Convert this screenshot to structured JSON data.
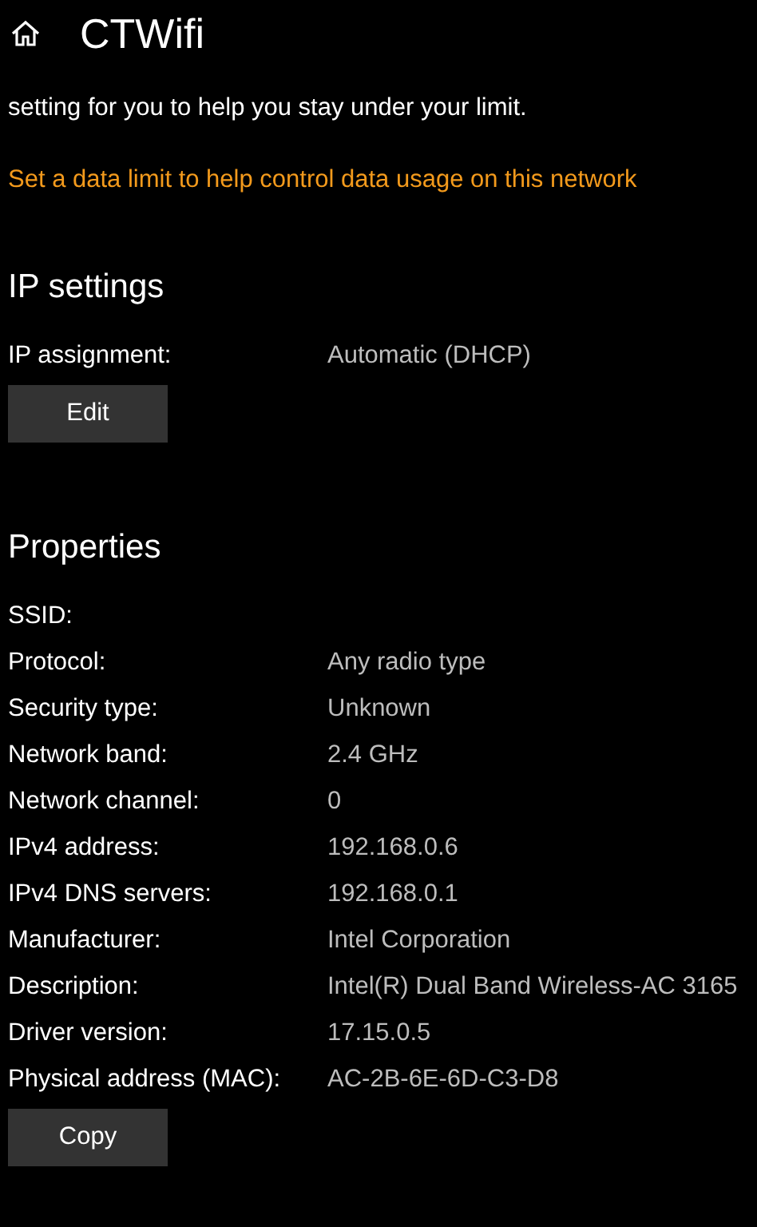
{
  "header": {
    "title": "CTWifi"
  },
  "intro": {
    "text": "setting for you to help you stay under your limit.",
    "link": "Set a data limit to help control data usage on this network"
  },
  "ip_settings": {
    "heading": "IP settings",
    "rows": [
      {
        "label": "IP assignment:",
        "value": "Automatic (DHCP)"
      }
    ],
    "button": "Edit"
  },
  "properties": {
    "heading": "Properties",
    "rows": [
      {
        "label": "SSID:"
      },
      {
        "label": "Protocol:",
        "value": "Any radio type"
      },
      {
        "label": "Security type:",
        "value": "Unknown"
      },
      {
        "label": "Network band:",
        "value": "2.4 GHz"
      },
      {
        "label": "Network channel:",
        "value": "0"
      },
      {
        "label": "IPv4 address:",
        "value": "192.168.0.6"
      },
      {
        "label": "IPv4 DNS servers:",
        "value": "192.168.0.1"
      },
      {
        "label": "Manufacturer:",
        "value": "Intel Corporation"
      },
      {
        "label": "Description:",
        "value": "Intel(R) Dual Band Wireless-AC 3165"
      },
      {
        "label": "Driver version:",
        "value": "17.15.0.5"
      },
      {
        "label": "Physical address (MAC):",
        "value": "AC-2B-6E-6D-C3-D8"
      }
    ],
    "button": "Copy"
  }
}
